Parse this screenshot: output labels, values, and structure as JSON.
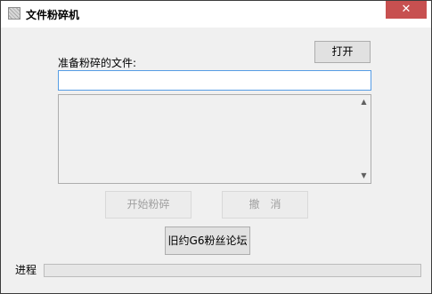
{
  "window": {
    "title": "文件粉碎机",
    "close_glyph": "✕"
  },
  "main": {
    "open_button": "打开",
    "file_label": "准备粉碎的文件:",
    "file_input_value": "",
    "start_button": "开始粉碎",
    "cancel_button": "撤　消",
    "forum_button": "旧约G6粉丝论坛",
    "progress_label": "进程",
    "progress_value": 0
  },
  "scrollbar": {
    "up_glyph": "▲",
    "down_glyph": "▼"
  }
}
